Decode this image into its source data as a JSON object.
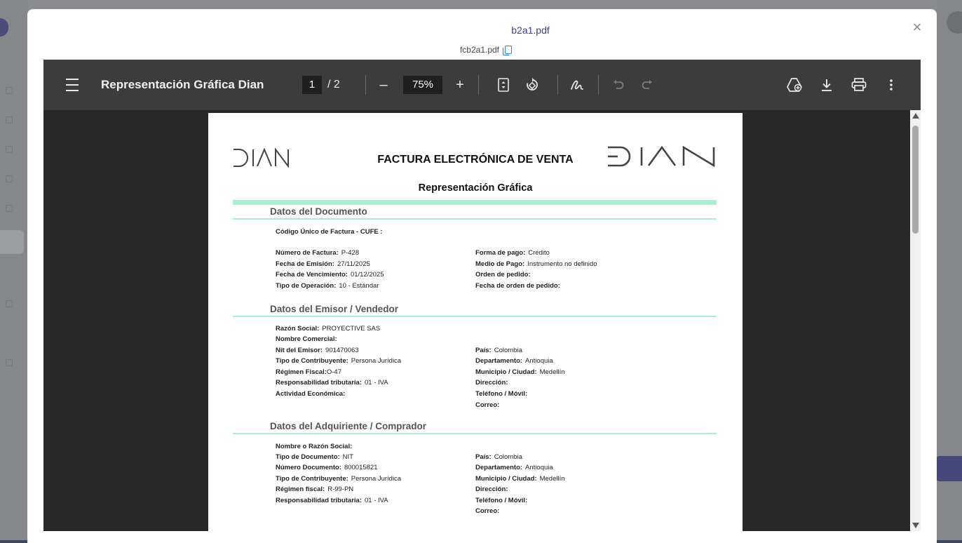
{
  "modal": {
    "title": "b2a1.pdf",
    "close": "×",
    "filename": "fcb2a1.pdf"
  },
  "toolbar": {
    "doc_title": "Representación Gráfica Dian",
    "page_current": "1",
    "page_total": "/  2",
    "zoom": "75%",
    "zoom_out": "–",
    "zoom_in": "+"
  },
  "document": {
    "logo": "DIAN",
    "title": "FACTURA ELECTRÓNICA DE VENTA",
    "subtitle": "Representación Gráfica",
    "sections": {
      "doc": "Datos del Documento",
      "emisor": "Datos del Emisor / Vendedor",
      "adquiriente": "Datos del Adquiriente / Comprador"
    },
    "doc_fields": {
      "cufe_label": "Código Único de Factura - CUFE :",
      "numero_label": "Número de Factura:",
      "numero": "P-428",
      "emision_label": "Fecha de Emisión:",
      "emision": "27/11/2025",
      "vencimiento_label": "Fecha de Vencimiento:",
      "vencimiento": "01/12/2025",
      "operacion_label": "Tipo de Operación:",
      "operacion": "10 - Estándar",
      "forma_pago_label": "Forma de pago:",
      "forma_pago": "Crédito",
      "medio_pago_label": "Medio de Pago:",
      "medio_pago": "Instrumento no definido",
      "orden_label": "Orden de pedido:",
      "fecha_orden_label": "Fecha de orden de pedido:"
    },
    "emisor_fields": {
      "razon_label": "Razón Social:",
      "razon": "PROYECTIVE SAS",
      "comercial_label": "Nombre Comercial:",
      "nit_label": "Nit del Emisor:",
      "nit": "901470063",
      "contrib_label": "Tipo de Contribuyente:",
      "contrib": "Persona Jurídica",
      "regimen_label": "Régimen Fiscal:",
      "regimen": "O-47",
      "resp_label": "Responsabilidad tributaria:",
      "resp": "01 - IVA",
      "actividad_label": "Actividad Económica:",
      "pais_label": "País:",
      "pais": "Colombia",
      "depto_label": "Departamento:",
      "depto": "Antioquia",
      "municipio_label": "Municipio / Ciudad:",
      "municipio": "Medellín",
      "direccion_label": "Dirección:",
      "telefono_label": "Teléfono / Móvil:",
      "correo_label": "Correo:"
    },
    "adq_fields": {
      "nombre_label": "Nombre o Razón Social:",
      "tipo_doc_label": "Tipo de Documento:",
      "tipo_doc": "NIT",
      "num_doc_label": "Número Documento:",
      "num_doc": "800015821",
      "contrib_label": "Tipo de Contribuyente:",
      "contrib": "Persona Jurídica",
      "regimen_label": "Régimen fiscal:",
      "regimen": "R-99-PN",
      "resp_label": "Responsabilidad tributaria:",
      "resp": "01 - IVA",
      "pais_label": "País:",
      "pais": "Colombia",
      "depto_label": "Departamento:",
      "depto": "Antioquia",
      "municipio_label": "Municipio / Ciudad:",
      "municipio": "Medellín",
      "direccion_label": "Dirección:",
      "telefono_label": "Teléfono / Móvil:",
      "correo_label": "Correo:"
    }
  }
}
